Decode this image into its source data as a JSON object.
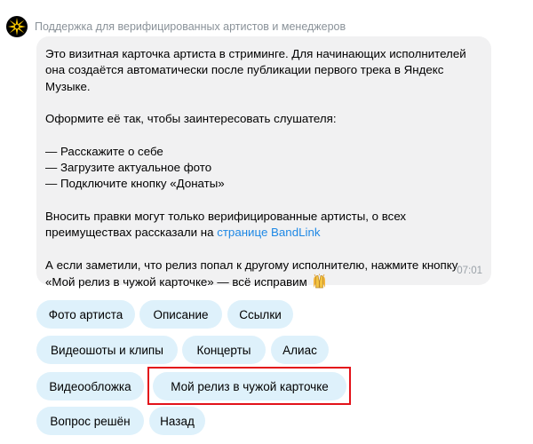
{
  "sender": {
    "name": "Поддержка для верифицированных артистов и менеджеров",
    "avatar_icon": "star-burst-icon"
  },
  "message": {
    "p1": "Это визитная карточка артиста в стриминге. Для начинающих исполнителей она создаётся автоматически после публикации первого трека в Яндекс Музыке.",
    "p2": "Оформите её так, чтобы заинтересовать слушателя:",
    "list": [
      "— Расскажите о себе",
      "— Загрузите актуальное фото",
      "— Подключите кнопку «Донаты»"
    ],
    "p4_text": "Вносить правки могут только верифицированные артисты, о всех преимуществах рассказали на ",
    "p4_link": "странице BandLink",
    "p5_text": "А если заметили, что релиз попал к другому исполнителю, нажмите кнопку «Мой релиз в чужой карточке» — всё исправим ",
    "p5_emoji": "raised-hands-icon",
    "time": "07:01"
  },
  "buttons": {
    "photo": "Фото артиста",
    "description": "Описание",
    "links": "Ссылки",
    "video": "Видеошоты и клипы",
    "concerts": "Концерты",
    "alias": "Алиас",
    "video_cover": "Видеообложка",
    "my_release": "Мой релиз в чужой карточке",
    "solved": "Вопрос решён",
    "back": "Назад"
  },
  "colors": {
    "button_bg": "#def1fb",
    "bubble_bg": "#f1f1f2",
    "link": "#1e88e5",
    "highlight": "#e3121a",
    "sender_text": "#8a9299"
  }
}
